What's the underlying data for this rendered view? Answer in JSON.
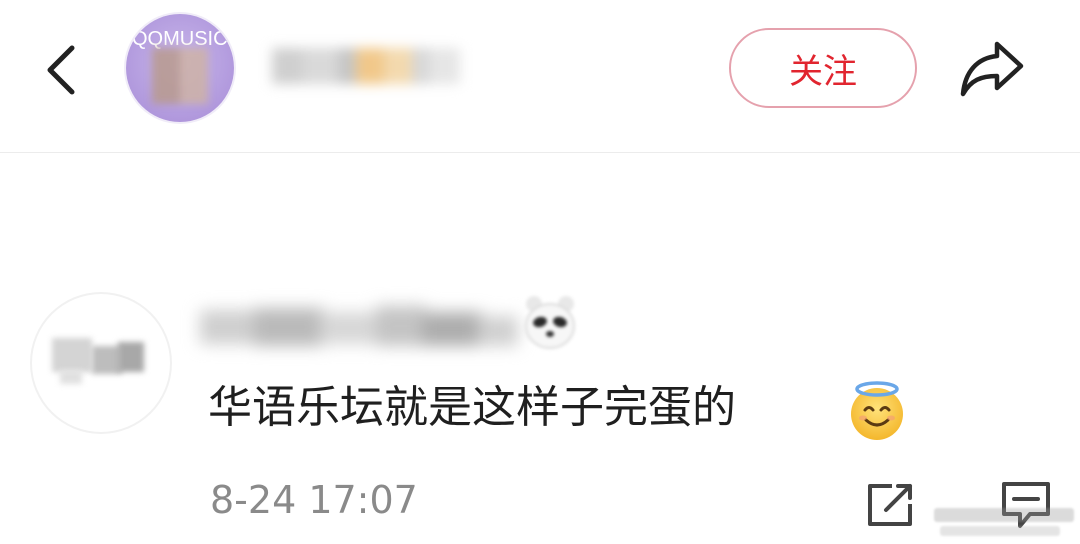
{
  "header": {
    "avatar_text": "QQMUSIC",
    "follow_label": "关注"
  },
  "comment": {
    "text": "华语乐坛就是这样子完蛋的",
    "timestamp": "8-24 17:07",
    "emoji_after_name": "panda-face-icon",
    "emoji_after_text": "smiling-face-with-halo-icon"
  },
  "colors": {
    "accent": "#e1252f",
    "follow_border": "#e5a1ad",
    "secondary_text": "#8a8a8a",
    "avatar_purple": "#b49ddf"
  }
}
